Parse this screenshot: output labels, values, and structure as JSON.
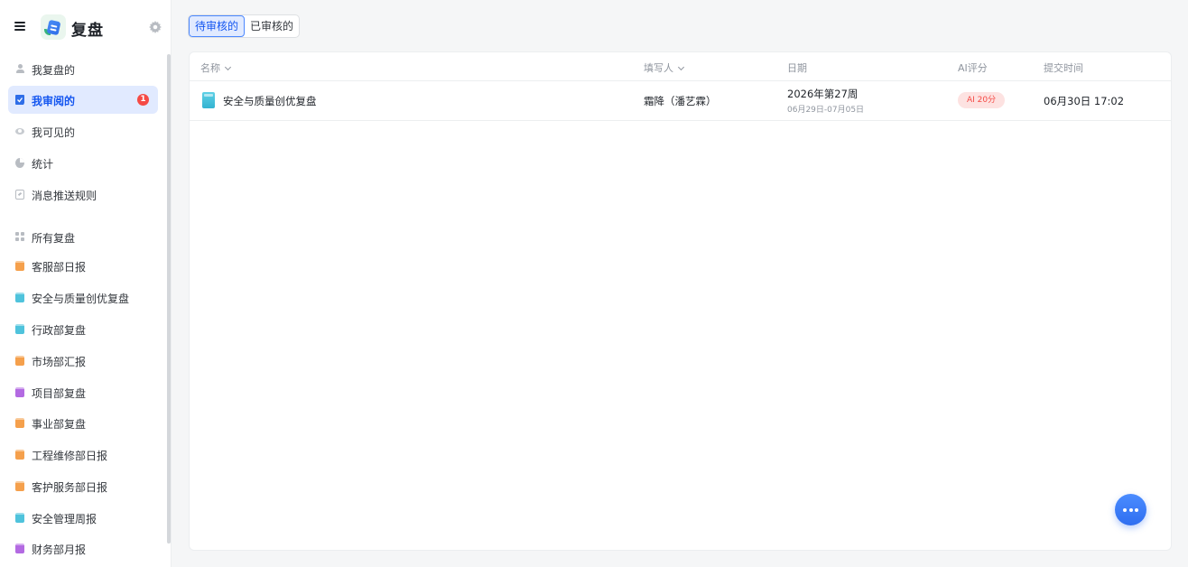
{
  "app": {
    "title": "复盘"
  },
  "sidebar": {
    "top_items": [
      {
        "label": "我复盘的",
        "icon": "person-icon"
      },
      {
        "label": "我审阅的",
        "icon": "review-icon",
        "badge": "1",
        "active": true
      },
      {
        "label": "我可见的",
        "icon": "eye-icon"
      },
      {
        "label": "统计",
        "icon": "pie-chart-icon"
      },
      {
        "label": "消息推送规则",
        "icon": "rule-icon"
      }
    ],
    "all_label": "所有复盘",
    "reports": [
      {
        "label": "客服部日报",
        "color": "#f5a04c"
      },
      {
        "label": "安全与质量创优复盘",
        "color": "#4fc3dc"
      },
      {
        "label": "行政部复盘",
        "color": "#4fc3dc"
      },
      {
        "label": "市场部汇报",
        "color": "#f5a04c"
      },
      {
        "label": "项目部复盘",
        "color": "#b36ae2"
      },
      {
        "label": "事业部复盘",
        "color": "#f5a04c"
      },
      {
        "label": "工程维修部日报",
        "color": "#f5a04c"
      },
      {
        "label": "客护服务部日报",
        "color": "#f5a04c"
      },
      {
        "label": "安全管理周报",
        "color": "#4fc3dc"
      },
      {
        "label": "财务部月报",
        "color": "#b36ae2"
      }
    ]
  },
  "tabs": {
    "pending": "待审核的",
    "reviewed": "已审核的"
  },
  "table": {
    "headers": {
      "name": "名称",
      "author": "填写人",
      "date": "日期",
      "ai": "AI评分",
      "submitted": "提交时间"
    },
    "rows": [
      {
        "name": "安全与质量创优复盘",
        "author": "霜降（潘艺霖）",
        "date": "2026年第27周",
        "date_range": "06月29日-07月05日",
        "ai_score": "AI 20分",
        "submitted": "06月30日 17:02"
      }
    ]
  },
  "colors": {
    "accent": "#1456f0",
    "active_bg": "#e1eaff",
    "badge": "#f54a45"
  }
}
